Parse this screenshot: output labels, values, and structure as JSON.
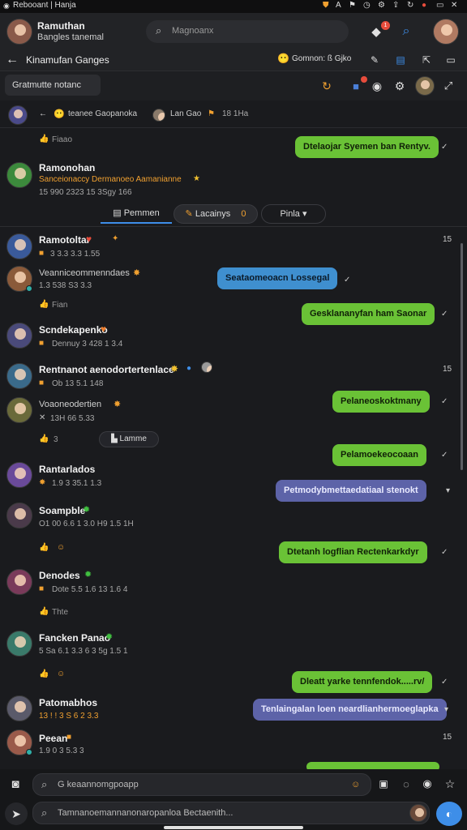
{
  "statusbar": {
    "title": "Rebooant | Hanja"
  },
  "header": {
    "name": "Ramuthan",
    "subtitle": "Bangles tanemal",
    "search_placeholder": "Magnoanx",
    "notify_count": "1"
  },
  "nav": {
    "title": "Kinamufan Ganges",
    "emoji": "😶",
    "status": "Gomnon: ß Gjko"
  },
  "toolbar": {
    "filter_label": "Gratmutte notanc"
  },
  "pinned": {
    "text": "teanee Gaopanoka",
    "text2": "Lan Gao",
    "time": "18 1Ha"
  },
  "feed": {
    "first_react": "Fiaao",
    "first_bubble": "Dtelaojar Syemen ban Rentyv.",
    "group": {
      "name": "Ramonohan",
      "line": "Sanceionaccy Dermanoeo Aamanianne",
      "date": "15 990 2323 15 3Sgy 166"
    },
    "tabs": [
      {
        "label": "Pemmen"
      },
      {
        "label": "Lacainys",
        "count": "0"
      },
      {
        "label": "Pinla"
      }
    ],
    "side_time": "15",
    "p1": {
      "name": "Ramotoltar",
      "meta": "3 3.3 3.3 1.55"
    },
    "p2": {
      "name": "Veanniceommenndaes",
      "meta": "1.3 538 S3 3.3"
    },
    "bubble_blue": "Seataomeoacn Lossegal",
    "react2": "Fian",
    "bubble_green1": "Gesklananyfan ham Saonar",
    "p3": {
      "name": "Scndekapenko",
      "meta": "Dennuy 3 428 1 3.4"
    },
    "p4": {
      "name": "Rentnanot aenodortertenlace",
      "meta": "Ob 13 5.1 148"
    },
    "p5": {
      "name": "Voaoneodertien",
      "meta": "13H 66 5.33"
    },
    "bubble_green2": "Pelaneoskoktmany",
    "react5_count": "3",
    "react5_pill": "Lamme",
    "bubble_green3": "Pelamoekeocoaan",
    "p6": {
      "name": "Rantarlados",
      "meta": "1.9 3 35.1 1.3"
    },
    "bubble_purple1": "Petmodybmettaedatiaal stenokt",
    "p7": {
      "name": "Soampble",
      "meta": "O1 00 6.6 1 3.0 H9 1.5 1H"
    },
    "bubble_green4": "Dtetanh logflian Rectenkarkdyr",
    "p8": {
      "name": "Denodes",
      "meta": "Dote 5.5 1.6 13 1.6 4"
    },
    "react8": "Thte",
    "p9": {
      "name": "Fancken Panao",
      "meta": "5 Sa 6.1 3.3 6 3 5g 1.5 1"
    },
    "bubble_green5": "Dleatt yarke tennfendok.....rv/",
    "p10": {
      "name": "Patomabhos",
      "meta": "13 ! ! 3 S 6 2 3.3"
    },
    "bubble_purple2": "Tenlaingalan loen neardlianhermoeglapka",
    "p11": {
      "name": "Peean",
      "meta": "1.9 0 3 5.3 3"
    }
  },
  "composer": {
    "reply_placeholder": "G keaannomgpoapp",
    "message_placeholder": "Tamnanoemannanonaropanloa Bectaenith..."
  },
  "colors": {
    "green": "#6ac236",
    "blue": "#3f8fcf",
    "purple": "#5d63a8",
    "accent": "#3e8ee8"
  }
}
